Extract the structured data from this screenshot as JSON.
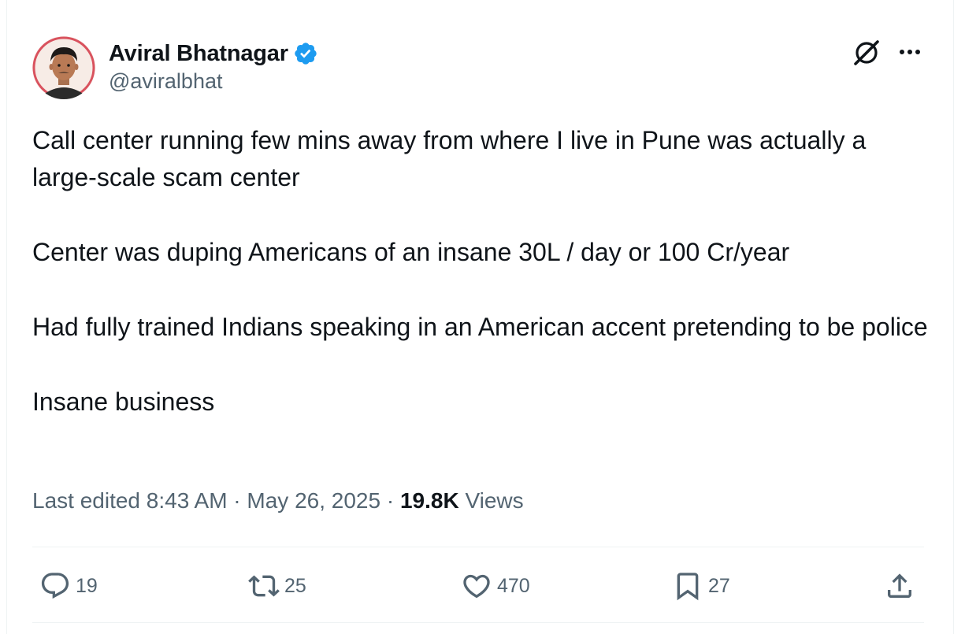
{
  "author": {
    "display_name": "Aviral Bhatnagar",
    "handle": "@aviralbhat",
    "verified": true,
    "verified_color": "#1d9bf0"
  },
  "icons": {
    "avatar": "profile-photo",
    "grok": "grok-icon",
    "more": "more-icon",
    "reply": "reply-icon",
    "retweet": "retweet-icon",
    "like": "heart-icon",
    "bookmark": "bookmark-icon",
    "share": "share-icon"
  },
  "tweet": {
    "paragraphs": [
      "Call center running few mins away from where I live in Pune was actually a large-scale scam center",
      "Center was duping Americans of an insane 30L / day or 100 Cr/year",
      "Had fully trained Indians speaking in an American accent pretending to be police",
      "Insane business"
    ]
  },
  "meta": {
    "edited_label": "Last edited",
    "time": "8:43 AM",
    "separator": "·",
    "date": "May 26, 2025",
    "views_count": "19.8K",
    "views_label": "Views"
  },
  "actions": {
    "replies": "19",
    "retweets": "25",
    "likes": "470",
    "bookmarks": "27"
  }
}
